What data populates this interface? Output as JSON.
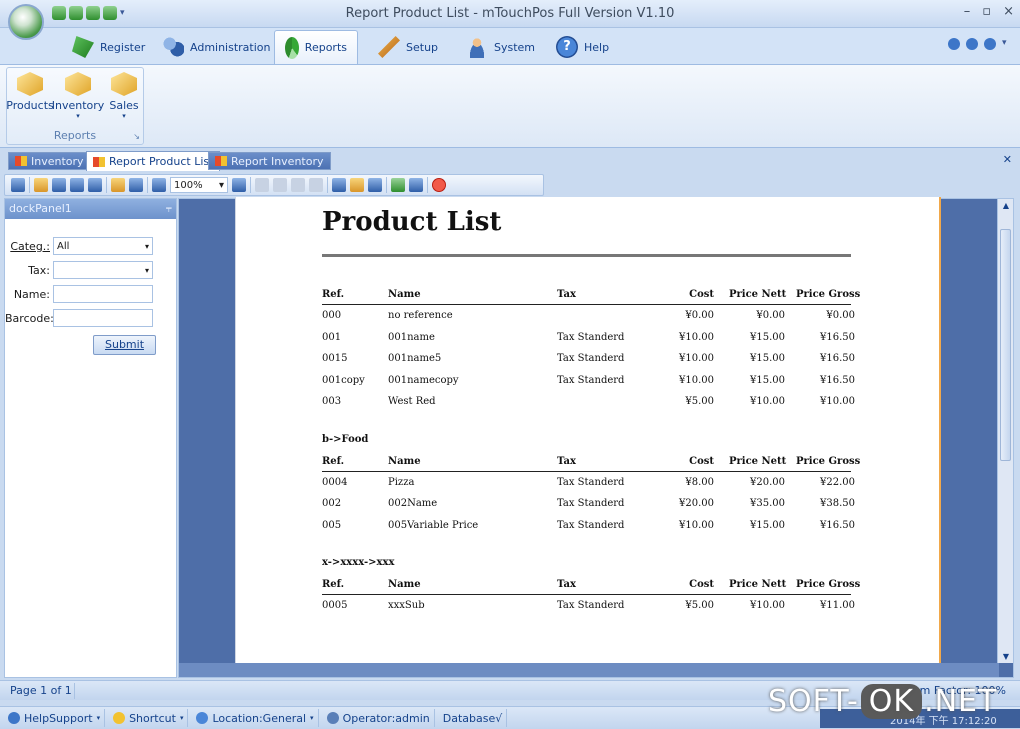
{
  "window": {
    "title": "Report Product List - mTouchPos Full Version V1.10",
    "controls": [
      "–",
      "▫",
      "×"
    ]
  },
  "ribbon": {
    "tabs": [
      {
        "label": "Register",
        "icon": "register-icon"
      },
      {
        "label": "Administration",
        "icon": "administration-icon"
      },
      {
        "label": "Reports",
        "icon": "reports-icon",
        "active": true
      },
      {
        "label": "Setup",
        "icon": "setup-icon"
      },
      {
        "label": "System",
        "icon": "system-icon"
      },
      {
        "label": "Help",
        "icon": "help-icon"
      }
    ],
    "group": {
      "label": "Reports",
      "buttons": [
        {
          "label": "Products",
          "icon": "products-box-icon"
        },
        {
          "label": "Inventory",
          "icon": "inventory-box-icon"
        },
        {
          "label": "Sales",
          "icon": "sales-box-icon"
        }
      ]
    }
  },
  "doc_tabs": [
    {
      "label": "Inventory",
      "active": false
    },
    {
      "label": "Report Product List",
      "active": true
    },
    {
      "label": "Report Inventory",
      "active": false
    }
  ],
  "toolbar": {
    "zoom_value": "100%"
  },
  "dock": {
    "title": "dockPanel1",
    "pin": "⫧",
    "fields": {
      "category": {
        "label": "Categ.:",
        "value": "All"
      },
      "tax": {
        "label": "Tax:",
        "value": ""
      },
      "name": {
        "label": "Name:",
        "value": ""
      },
      "barcode": {
        "label": "Barcode:",
        "value": ""
      }
    },
    "submit_label": "Submit"
  },
  "report": {
    "title": "Product List",
    "columns": [
      "Ref.",
      "Name",
      "Tax",
      "Cost",
      "Price Nett",
      "Price Gross"
    ],
    "sections": [
      {
        "group": "",
        "rows": [
          [
            "000",
            "no reference",
            "",
            "¥0.00",
            "¥0.00",
            "¥0.00"
          ],
          [
            "001",
            "001name",
            "Tax Standerd",
            "¥10.00",
            "¥15.00",
            "¥16.50"
          ],
          [
            "0015",
            "001name5",
            "Tax Standerd",
            "¥10.00",
            "¥15.00",
            "¥16.50"
          ],
          [
            "001copy",
            "001namecopy",
            "Tax Standerd",
            "¥10.00",
            "¥15.00",
            "¥16.50"
          ],
          [
            "003",
            "West Red",
            "",
            "¥5.00",
            "¥10.00",
            "¥10.00"
          ]
        ]
      },
      {
        "group": "b->Food",
        "rows": [
          [
            "0004",
            "Pizza",
            "Tax Standerd",
            "¥8.00",
            "¥20.00",
            "¥22.00"
          ],
          [
            "002",
            "002Name",
            "Tax Standerd",
            "¥20.00",
            "¥35.00",
            "¥38.50"
          ],
          [
            "005",
            "005Variable Price",
            "Tax Standerd",
            "¥10.00",
            "¥15.00",
            "¥16.50"
          ]
        ]
      },
      {
        "group": "x->xxxx->xxx",
        "rows": [
          [
            "0005",
            "xxxSub",
            "Tax Standerd",
            "¥5.00",
            "¥10.00",
            "¥11.00"
          ]
        ]
      }
    ]
  },
  "status": {
    "page": "Page 1 of 1",
    "zoom": "Zoom Factor: 100%",
    "items": [
      {
        "label": "HelpSupport",
        "icon": "help-support-icon",
        "dropdown": true
      },
      {
        "label": "Shortcut",
        "icon": "shortcut-icon",
        "dropdown": true
      },
      {
        "label": "Location:General",
        "icon": "location-icon",
        "dropdown": true
      },
      {
        "label": "Operator:admin",
        "icon": "operator-icon",
        "dropdown": false
      },
      {
        "label": "Database√",
        "icon": "",
        "dropdown": false
      }
    ],
    "clock": "2014年 下午 17:12:20"
  },
  "watermark": {
    "left": "SOFT-",
    "middle": "OK",
    "right": ".NET"
  }
}
